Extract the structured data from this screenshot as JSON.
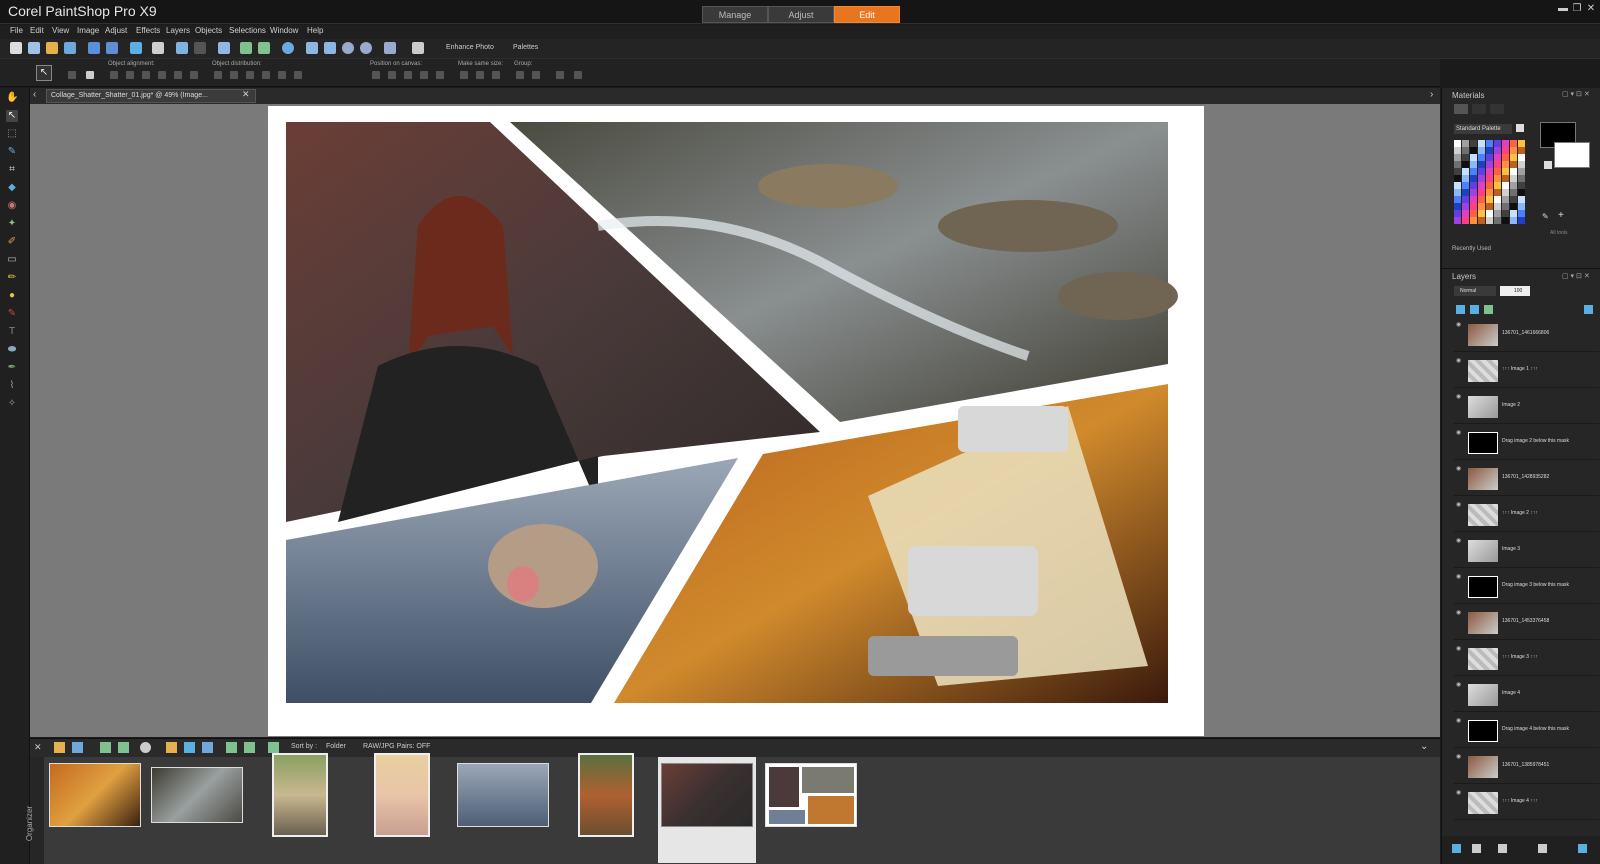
{
  "app": {
    "title": "Corel PaintShop Pro X9",
    "workspaces": [
      "Manage",
      "Adjust",
      "Edit"
    ],
    "active_workspace": "Edit"
  },
  "menu": [
    "File",
    "Edit",
    "View",
    "Image",
    "Adjust",
    "Effects",
    "Layers",
    "Objects",
    "Selections",
    "Window",
    "Help"
  ],
  "toolbar": {
    "enhance_photo": "Enhance Photo",
    "palettes": "Palettes"
  },
  "options": {
    "object_alignment": "Object alignment:",
    "object_distribution": "Object distribution:",
    "position_on_canvas": "Position on canvas:",
    "make_same_size": "Make same size:",
    "group": "Group:"
  },
  "document": {
    "tab_label": "Collage_Shatter_Shatter_01.jpg* @ 49% (Image..."
  },
  "organizer": {
    "label": "Organizer",
    "sort_by_label": "Sort by :",
    "sort_by_value": "Folder",
    "raw_jpg_pairs": "RAW/JPG Pairs: OFF"
  },
  "materials": {
    "title": "Materials",
    "palette": "Standard Palette",
    "recently_used": "Recently Used",
    "all_tools": "All tools"
  },
  "layers": {
    "title": "Layers",
    "blend_mode": "Normal",
    "opacity": "100",
    "items": [
      {
        "name": "136701_1461666806",
        "type": "photo"
      },
      {
        "name": "↑↑↑ Image 1 ↑↑↑",
        "type": "placeholder"
      },
      {
        "name": "Image 2",
        "type": "group"
      },
      {
        "name": "Drag image 2 below this mask",
        "type": "mask"
      },
      {
        "name": "136701_1428935282",
        "type": "photo"
      },
      {
        "name": "↑↑↑ Image 2 ↑↑↑",
        "type": "placeholder"
      },
      {
        "name": "Image 3",
        "type": "group"
      },
      {
        "name": "Drag image 3 below this mask",
        "type": "mask"
      },
      {
        "name": "136701_1453376458",
        "type": "photo"
      },
      {
        "name": "↑↑↑ Image 3 ↑↑↑",
        "type": "placeholder"
      },
      {
        "name": "Image 4",
        "type": "group"
      },
      {
        "name": "Drag image 4 below this mask",
        "type": "mask"
      },
      {
        "name": "136701_1385978451",
        "type": "photo"
      },
      {
        "name": "↑↑↑ Image 4 ↑↑↑",
        "type": "placeholder"
      }
    ]
  },
  "colors": {
    "accent": "#e8761e",
    "workspace": "#7a7a7a",
    "panel": "#262626"
  }
}
